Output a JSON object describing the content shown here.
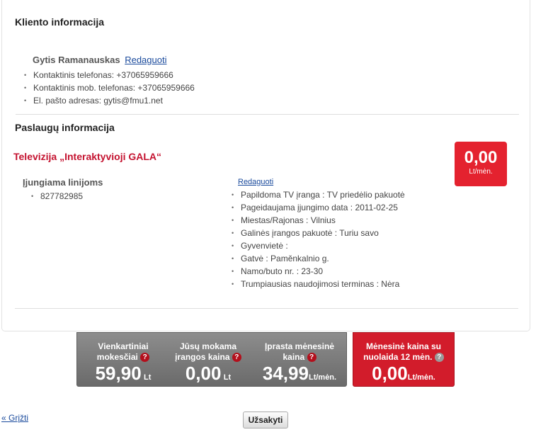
{
  "client": {
    "section_title": "Kliento informacija",
    "name": "Gytis Ramanauskas",
    "edit_label": "Redaguoti",
    "details": [
      "Kontaktinis telefonas: +37065959666",
      "Kontaktinis mob. telefonas: +37065959666",
      "El. pašto adresas: gytis@fmu1.net"
    ]
  },
  "services": {
    "section_title": "Paslaugų informacija",
    "tv_title": "Televizija „Interaktyvioji GALA“",
    "price_value": "0,00",
    "price_unit": "Lt/mėn.",
    "lines_label": "Įjungiama linijoms",
    "lines": [
      "827782985"
    ],
    "edit_label": "Redaguoti",
    "properties": [
      "Papildoma TV įranga : TV priedėlio pakuotė",
      "Pageidaujama įjungimo data : 2011-02-25",
      "Miestas/Rajonas : Vilnius",
      "Galinės įrangos pakuotė : Turiu savo",
      "Gyvenvietė :",
      "Gatvė : Paměnkalnio g.",
      "Namo/buto nr. : 23-30",
      "Trumpiausias naudojimosi terminas : Nėra"
    ]
  },
  "summary": {
    "one_time": {
      "label1": "Vienkartiniai",
      "label2": "mokesčiai",
      "value": "59,90",
      "unit": "Lt"
    },
    "equipment": {
      "label1": "Jūsų mokama",
      "label2": "įrangos kaina",
      "value": "0,00",
      "unit": "Lt"
    },
    "monthly": {
      "label1": "Įprasta mėnesinė",
      "label2": "kaina",
      "value": "34,99",
      "unit": "Lt/mėn."
    },
    "discount": {
      "label1": "Mėnesinė kaina su",
      "label2": "nuolaida 12 mėn.",
      "value": "0,00",
      "unit": "Lt/mėn."
    }
  },
  "actions": {
    "back_label": "« Grįžti",
    "order_label": "Užsakyti"
  }
}
